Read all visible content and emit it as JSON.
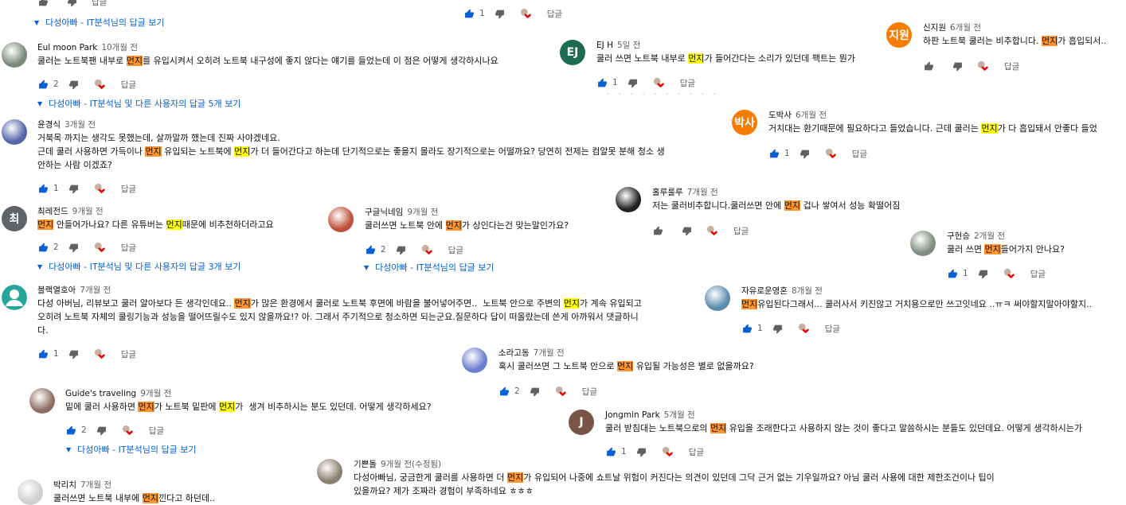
{
  "comments": [
    {
      "id": "c1",
      "author": "Eul moon Park",
      "time": "10개월 전",
      "text": [
        "쿨러는 노트북팬 내부로 ",
        {
          "hl": "o",
          "t": "먼지"
        },
        "를 유입시켜서 오히려 노트북 내구성에 좋지 않다는 얘기를 들었는데 이 점은 어떻게 생각하시나요"
      ],
      "likes": "2",
      "avatar": {
        "type": "img",
        "color": "#7a8a7a"
      }
    },
    {
      "id": "c2",
      "author": "윤경식",
      "time": "3개월 전",
      "text": [
        "거북목 까지는 생각도 못했는데, 살까말까 했는데 진짜 사야겠네요.\n근데 쿨러 사용하면 가득이나 ",
        {
          "hl": "o",
          "t": "먼지"
        },
        " 유입되는 노트북에 ",
        {
          "hl": "y",
          "t": "먼지"
        },
        "가 더 들어간다고 하는데 단기적으로는 좋을지 몰라도 장기적으로는 어떨까요? 당연히 전제는 컴알못 분해 청소 생\n안하는 사람 이겠죠?"
      ],
      "likes": "1",
      "avatar": {
        "type": "img",
        "color": "#5566aa"
      }
    },
    {
      "id": "c3",
      "author": "최레전드",
      "time": "9개월 전",
      "text": [
        {
          "hl": "o",
          "t": "먼지"
        },
        " 안들어가나요? 다른 유튜버는 ",
        {
          "hl": "y",
          "t": "먼지"
        },
        "때문에 비추천하더라고요"
      ],
      "likes": "2",
      "avatar": {
        "type": "letter",
        "letter": "최",
        "color": "#5f6368"
      }
    },
    {
      "id": "c4",
      "author": "블랙열호아",
      "time": "7개월 전",
      "text": [
        "다성 아버님, 리뷰보고 쿨러 알아보다 든 생각인데요.. ",
        {
          "hl": "o",
          "t": "먼지"
        },
        "가 많은 환경에서 쿨러로 노트북 후면에 바람을 불어넣어주면..  노트북 안으로 주변의 ",
        {
          "hl": "y",
          "t": "먼지"
        },
        "가 계속 유입되고\n오히려 노트북 자체의 쿨링기능과 성능을 떨어뜨릴수도 있지 않을까요!? 아. 그래서 주기적으로 청소하면 되는군요.질문하다 답이 떠올랐는데 쓴게 아까워서 댓글하니\n다."
      ],
      "likes": "1",
      "avatar": {
        "type": "person",
        "color": "#26a69a"
      }
    },
    {
      "id": "c5",
      "author": "Guide's traveling",
      "time": "9개월 전",
      "text": [
        "밑에 쿨러 사용하면 ",
        {
          "hl": "o",
          "t": "먼지"
        },
        "가 노트북 밑판에 ",
        {
          "hl": "y",
          "t": "먼지"
        },
        "가  생겨 비추하시는 분도 있던데. 어떻게 생각하세요?"
      ],
      "likes": "2",
      "avatar": {
        "type": "img",
        "color": "#8d6e63"
      }
    },
    {
      "id": "c6",
      "author": "박리치",
      "time": "7개월 전",
      "text": [
        "쿨러쓰면 노트북 내부에 ",
        {
          "hl": "o",
          "t": "먼지"
        },
        "낀다고 하던데.."
      ],
      "likes": "",
      "avatar": {
        "type": "img",
        "color": "#cfcfcf"
      }
    },
    {
      "id": "c7",
      "author": "EJ H",
      "time": "5일 전",
      "text": [
        "쿨러 쓰면 노트북 내부로 ",
        {
          "hl": "y",
          "t": "먼지"
        },
        "가 들어간다는 소리가 있던데 팩트는 뭔가"
      ],
      "likes": "1",
      "avatar": {
        "type": "letter",
        "letter": "EJ",
        "color": "#1e6b52"
      }
    },
    {
      "id": "c8",
      "author": "구글닉네임",
      "time": "9개월 전",
      "text": [
        "쿨러쓰면 노트북 안에 ",
        {
          "hl": "o",
          "t": "먼지"
        },
        "가 상인다는건 맞는말인가요?"
      ],
      "likes": "2",
      "avatar": {
        "type": "img",
        "color": "#c0503a"
      }
    },
    {
      "id": "c9",
      "author": "소라고동",
      "time": "7개월 전",
      "text": [
        "혹시 쿨러쓰면 그 노트북 안으로 ",
        {
          "hl": "o",
          "t": "먼지"
        },
        " 유입될 가능성은 별로 없을까요?"
      ],
      "likes": "2",
      "avatar": {
        "type": "img",
        "color": "#6a7fd0"
      }
    },
    {
      "id": "c10",
      "author": "Jongmin Park",
      "time": "5개월 전",
      "text": [
        "쿨러 받침대는 노트북으로의 ",
        {
          "hl": "o",
          "t": "먼지"
        },
        " 유입을 조래한다고 사용하지 않는 것이 좋다고 말씀하시는 분들도 있던데요. 어떻게 생각하시는가"
      ],
      "likes": "1",
      "avatar": {
        "type": "letter",
        "letter": "J",
        "color": "#795548"
      }
    },
    {
      "id": "c11",
      "author": "기쁜돌",
      "time": "9개월 전(수정됨)",
      "text": [
        "다성아빠님, 궁금한게 쿨러를 사용하면 더 ",
        {
          "hl": "o",
          "t": "먼지"
        },
        "가 유입되어 나중에 쇼트날 위험이 커진다는 의견이 있던데 그닥 근거 없는 기우일까요? 아님 쿨러 사용에 대한 제한조건이나 팁이\n있을까요? 제가 조짜라 경험이 부족하네요 ㅎㅎㅎ"
      ],
      "likes": "",
      "avatar": {
        "type": "img",
        "color": "#8a8070"
      }
    },
    {
      "id": "c12",
      "author": "신지원",
      "time": "6개월 전",
      "text": [
        "하판 노트북 쿨러는 비추합니다. ",
        {
          "hl": "o",
          "t": "먼지"
        },
        "가 흡입되서.."
      ],
      "likes": "",
      "avatar": {
        "type": "letter",
        "letter": "지원",
        "color": "#f57c00"
      }
    },
    {
      "id": "c13",
      "author": "도박사",
      "time": "6개월 전",
      "text": [
        "거치대는 환기때문에 필요하다고 들었습니다. 근데 쿨러는 ",
        {
          "hl": "y",
          "t": "먼지"
        },
        "가 다 흡입돼서 안좋다 들었"
      ],
      "likes": "1",
      "avatar": {
        "type": "letter",
        "letter": "박사",
        "color": "#f57c00"
      }
    },
    {
      "id": "c14",
      "author": "홀루룰루",
      "time": "7개월 전",
      "text": [
        "저는 쿨러비추합니다.쿨러쓰면 안에 ",
        {
          "hl": "o",
          "t": "먼지"
        },
        " 겁나 쌓여서 성능 확떨어짐"
      ],
      "likes": "",
      "avatar": {
        "type": "img",
        "color": "#222222"
      }
    },
    {
      "id": "c15",
      "author": "구헌승",
      "time": "2개월 전",
      "text": [
        "쿨러 쓰면 ",
        {
          "hl": "o",
          "t": "먼지"
        },
        "들어가지 안나요?"
      ],
      "likes": "1",
      "avatar": {
        "type": "img",
        "color": "#7f8c7f"
      }
    },
    {
      "id": "c16",
      "author": "자유로운영혼",
      "time": "8개월 전",
      "text": [
        {
          "hl": "o",
          "t": "먼지"
        },
        "유입된다그래서... 쿨러사서 키진않고 거치용으로만 쓰고잇네요 ..ㅠㅋ 써야할지말아야할지.."
      ],
      "likes": "1",
      "avatar": {
        "type": "img",
        "color": "#5b8db0"
      }
    }
  ],
  "top_actions": [
    {
      "id": "t1",
      "likes": ""
    },
    {
      "id": "t2",
      "likes": "1"
    }
  ],
  "view_replies": {
    "v0": "다성아빠 - IT분석님의 답글 보기",
    "v1": "다성아빠 - IT분석님 및 다른 사용자의 답글 5개 보기",
    "v2": "다성아빠 - IT분석님 및 다른 사용자의 답글 3개 보기",
    "v3": "다성아빠 - IT분석님의 답글 보기",
    "v4": "다성아빠 - IT분석님의 답글 보기"
  },
  "labels": {
    "reply": "답글"
  },
  "colors": {
    "highlight_yellow": "#ffff00",
    "highlight_orange": "#ff9632",
    "link_blue": "#065fd4",
    "like_blue": "#065fd4"
  },
  "icons": {
    "like": "thumb-up-icon",
    "dislike": "thumb-down-icon",
    "heart": "creator-heart-icon",
    "caret": "caret-down-icon"
  }
}
